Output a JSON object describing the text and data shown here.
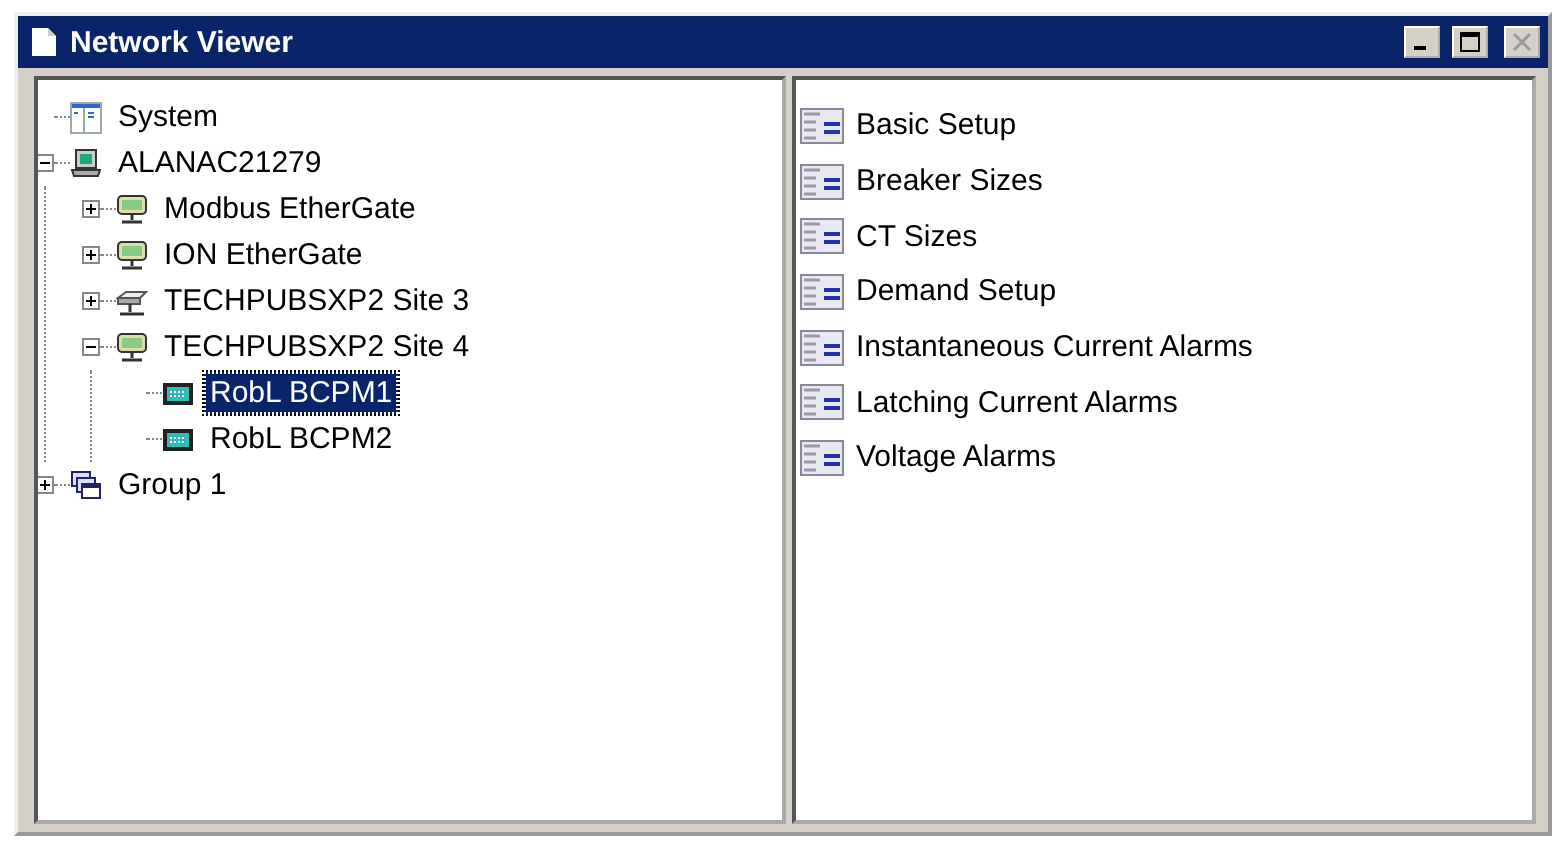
{
  "window": {
    "title": "Network Viewer"
  },
  "tree": [
    {
      "label": "System",
      "kind": "system",
      "selected": false
    },
    {
      "label": "ALANAC21279",
      "kind": "computer",
      "selected": false,
      "expanded": true,
      "children": [
        {
          "label": "Modbus EtherGate",
          "kind": "gateway",
          "selected": false,
          "expanded": false
        },
        {
          "label": "ION EtherGate",
          "kind": "gateway",
          "selected": false,
          "expanded": false
        },
        {
          "label": "TECHPUBSXP2 Site 3",
          "kind": "hub",
          "selected": false,
          "expanded": false
        },
        {
          "label": "TECHPUBSXP2 Site 4",
          "kind": "gateway",
          "selected": false,
          "expanded": true,
          "children": [
            {
              "label": "RobL BCPM1",
              "kind": "device",
              "selected": true
            },
            {
              "label": "RobL BCPM2",
              "kind": "device",
              "selected": false
            }
          ]
        }
      ]
    },
    {
      "label": "Group 1",
      "kind": "group",
      "selected": false,
      "expanded": false
    }
  ],
  "list": [
    {
      "label": "Basic Setup",
      "selected": false
    },
    {
      "label": "Breaker Sizes",
      "selected": false
    },
    {
      "label": "CT Sizes",
      "selected": false
    },
    {
      "label": "Demand Setup",
      "selected": false
    },
    {
      "label": "Instantaneous Current Alarms",
      "selected": false
    },
    {
      "label": "Latching Current Alarms",
      "selected": false
    },
    {
      "label": "Voltage Alarms",
      "selected": false
    }
  ]
}
